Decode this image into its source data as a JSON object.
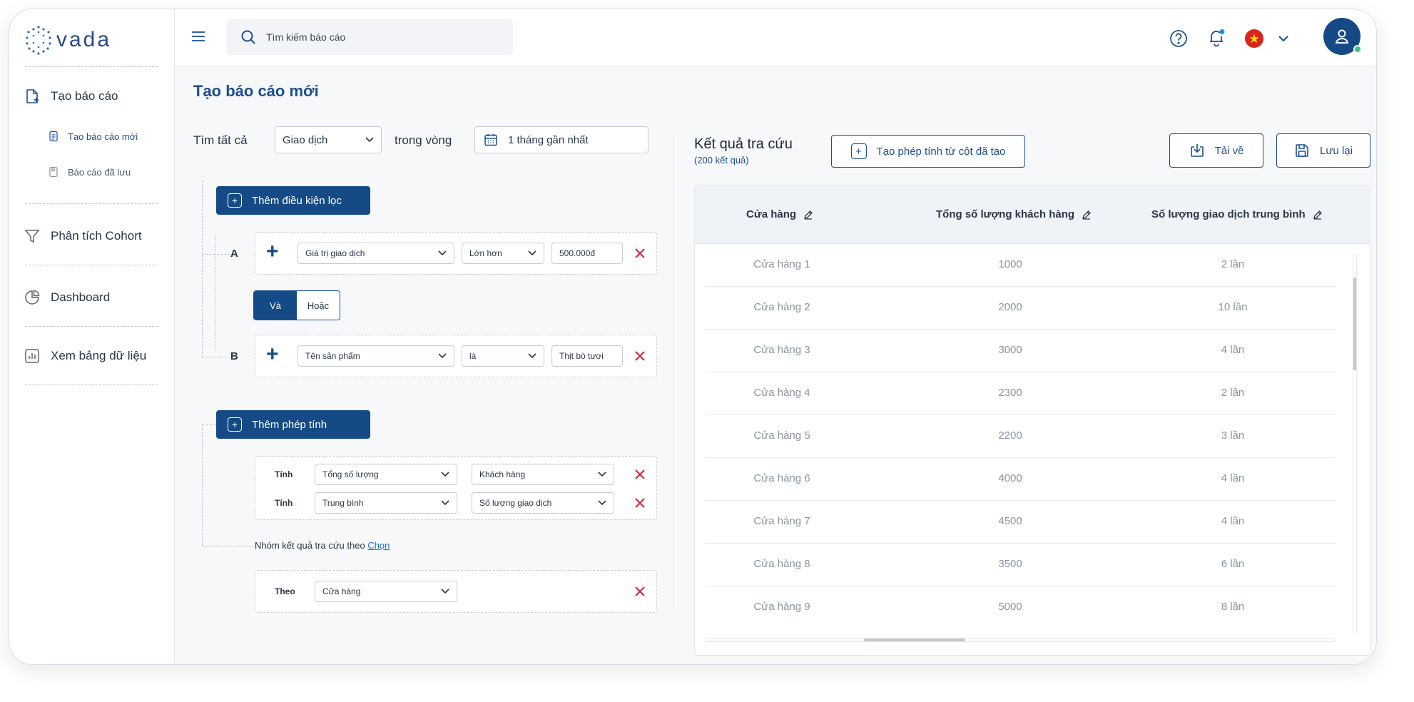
{
  "app": {
    "logo_text": "vada"
  },
  "sidebar": {
    "items": [
      {
        "label": "Tạo báo cáo"
      },
      {
        "label": "Phân tích Cohort"
      },
      {
        "label": "Dashboard"
      },
      {
        "label": "Xem bảng dữ liệu"
      }
    ],
    "subitems": [
      {
        "label": "Tạo báo cáo mới"
      },
      {
        "label": "Báo cáo đã lưu"
      }
    ]
  },
  "topbar": {
    "search_placeholder": "Tìm kiếm báo cáo"
  },
  "page": {
    "title": "Tạo báo cáo mới"
  },
  "filter": {
    "find_all_label": "Tìm tất cả",
    "type_value": "Giao dịch",
    "within_label": "trong vòng",
    "date_value": "1 tháng gần nhất",
    "add_condition_label": "Thêm điều kiện lọc",
    "conditions": [
      {
        "letter": "A",
        "field": "Giá trị giao dịch",
        "operator": "Lớn hơn",
        "value": "500.000đ"
      },
      {
        "letter": "B",
        "field": "Tên sản phẩm",
        "operator": "là",
        "value": "Thịt bò tươi"
      }
    ],
    "logic": {
      "and_label": "Và",
      "or_label": "Hoặc"
    }
  },
  "calc": {
    "add_calc_label": "Thêm phép tính",
    "rows": [
      {
        "label": "Tính",
        "func": "Tổng số lượng",
        "field": "Khách hàng"
      },
      {
        "label": "Tính",
        "func": "Trung bình",
        "field": "Số lượng giao dịch"
      }
    ],
    "group_text": "Nhóm kết quả tra cứu theo",
    "group_link": "Chọn",
    "group_by_label": "Theo",
    "group_by_value": "Cửa hàng"
  },
  "results": {
    "title": "Kết quả tra cứu",
    "count": "(200 kết quả)",
    "create_calc_label": "Tạo phép tính từ cột đã tạo",
    "download_label": "Tải về",
    "save_label": "Lưu lại",
    "columns": [
      "Cửa hàng",
      "Tổng số lượng khách hàng",
      "Số lượng giao dịch trung bình"
    ],
    "rows": [
      [
        "Cửa hàng 1",
        "1000",
        "2 lần"
      ],
      [
        "Cửa hàng 2",
        "2000",
        "10 lần"
      ],
      [
        "Cửa hàng 3",
        "3000",
        "4 lần"
      ],
      [
        "Cửa hàng 4",
        "2300",
        "2 lần"
      ],
      [
        "Cửa hàng 5",
        "2200",
        "3 lần"
      ],
      [
        "Cửa hàng 6",
        "4000",
        "4 lần"
      ],
      [
        "Cửa hàng 7",
        "4500",
        "4 lần"
      ],
      [
        "Cửa hàng 8",
        "3500",
        "6 lần"
      ],
      [
        "Cửa hàng 9",
        "5000",
        "8 lần"
      ]
    ]
  },
  "colors": {
    "primary": "#154a86",
    "danger": "#d62839",
    "accent": "#1d6fd1"
  }
}
